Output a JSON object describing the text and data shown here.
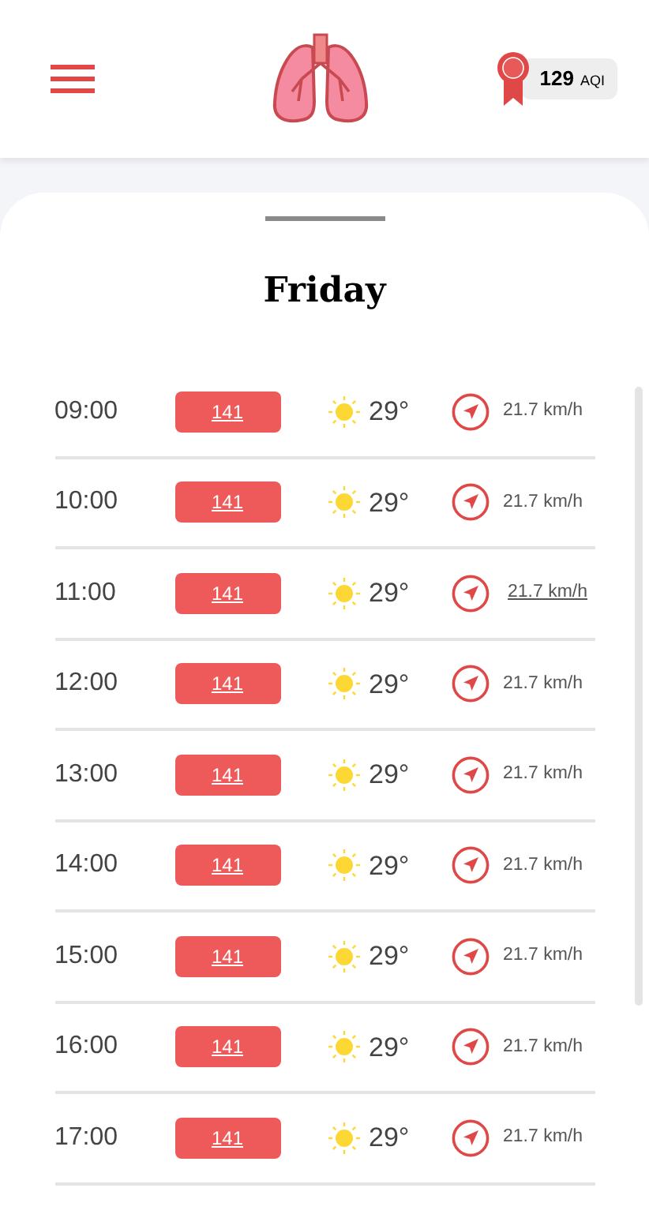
{
  "header": {
    "aqi": {
      "value": "129",
      "unit": "AQI"
    }
  },
  "day": {
    "title": "Friday"
  },
  "rows": [
    {
      "time": "09:00",
      "aqi": "141",
      "temp": "29°",
      "wind": "21.7 km/h",
      "underlined": false
    },
    {
      "time": "10:00",
      "aqi": "141",
      "temp": "29°",
      "wind": "21.7 km/h",
      "underlined": false
    },
    {
      "time": "11:00",
      "aqi": "141",
      "temp": "29°",
      "wind": "21.7 km/h",
      "underlined": true
    },
    {
      "time": "12:00",
      "aqi": "141",
      "temp": "29°",
      "wind": "21.7 km/h",
      "underlined": false
    },
    {
      "time": "13:00",
      "aqi": "141",
      "temp": "29°",
      "wind": "21.7 km/h",
      "underlined": false
    },
    {
      "time": "14:00",
      "aqi": "141",
      "temp": "29°",
      "wind": "21.7 km/h",
      "underlined": false
    },
    {
      "time": "15:00",
      "aqi": "141",
      "temp": "29°",
      "wind": "21.7 km/h",
      "underlined": false
    },
    {
      "time": "16:00",
      "aqi": "141",
      "temp": "29°",
      "wind": "21.7 km/h",
      "underlined": false
    },
    {
      "time": "17:00",
      "aqi": "141",
      "temp": "29°",
      "wind": "21.7 km/h",
      "underlined": false
    }
  ]
}
